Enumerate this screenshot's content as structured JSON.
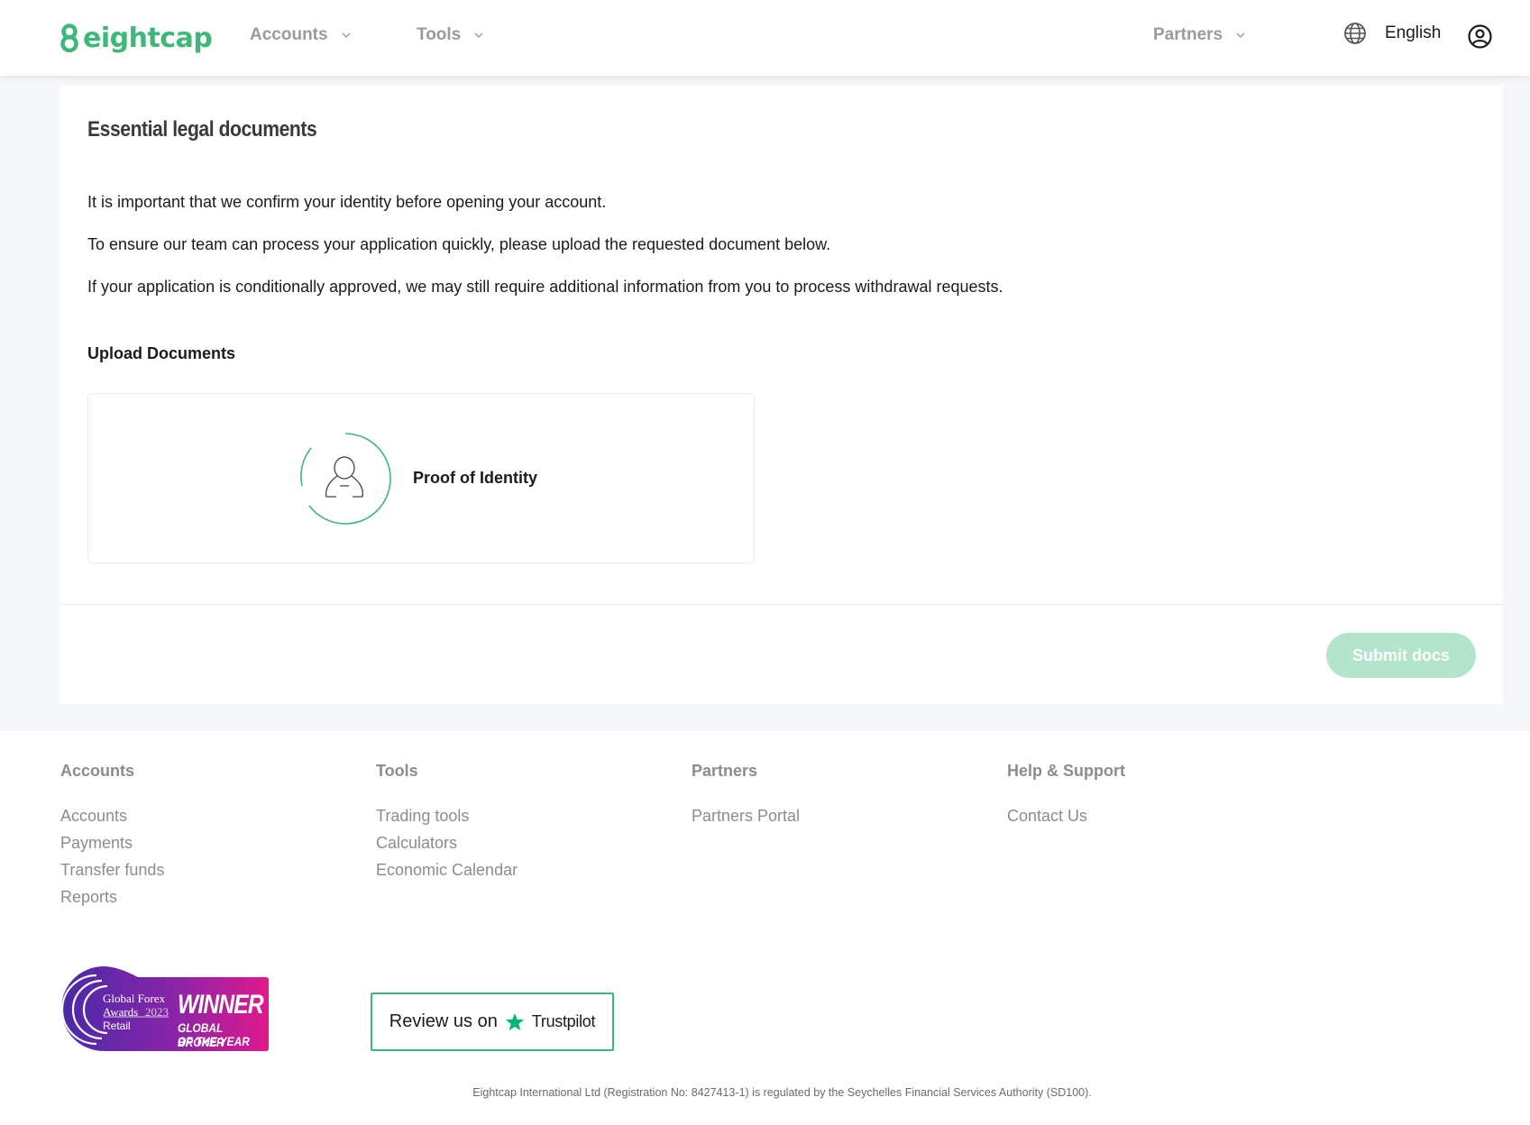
{
  "colors": {
    "brand": "#3cb878",
    "submit_disabled": "#b3e5cc",
    "page_bg": "#f5f6f8"
  },
  "header": {
    "logo_text": "eightcap",
    "nav": {
      "accounts": "Accounts",
      "tools": "Tools",
      "partners": "Partners"
    },
    "language": "English",
    "icons": {
      "language": "globe-icon",
      "user": "user-circle-icon",
      "dropdown": "chevron-down-icon"
    }
  },
  "main": {
    "title": "Essential legal documents",
    "paragraphs": [
      "It is important that we confirm your identity before opening your account.",
      "To ensure our team can process your application quickly, please upload the requested document below.",
      "If your application is conditionally approved, we may still require additional information from you to process withdrawal requests."
    ],
    "upload_heading": "Upload Documents",
    "document": {
      "label": "Proof of Identity",
      "icon": "person-icon"
    },
    "submit_label": "Submit docs"
  },
  "footer": {
    "columns": [
      {
        "heading": "Accounts",
        "links": [
          "Accounts",
          "Payments",
          "Transfer funds",
          "Reports"
        ]
      },
      {
        "heading": "Tools",
        "links": [
          "Trading tools",
          "Calculators",
          "Economic Calendar"
        ]
      },
      {
        "heading": "Partners",
        "links": [
          "Partners Portal"
        ]
      },
      {
        "heading": "Help & Support",
        "links": [
          "Contact Us"
        ]
      }
    ],
    "award": {
      "line1": "Global Forex",
      "line2": "Awards",
      "year": "2023",
      "line3": "Retail",
      "winner": "WINNER",
      "sub1": "GLOBAL BROKER",
      "sub2": "OF THE YEAR"
    },
    "trustpilot": {
      "text": "Review us on",
      "brand": "Trustpilot"
    },
    "legal": "Eightcap International Ltd (Registration No: 8427413-1) is regulated by the Seychelles Financial Services Authority (SD100)."
  }
}
